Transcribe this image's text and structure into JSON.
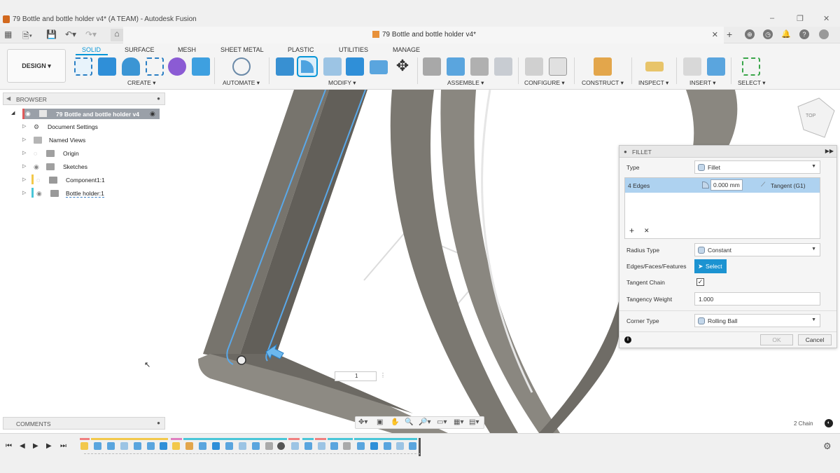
{
  "window": {
    "title": "79 Bottle and bottle holder v4* (A TEAM) - Autodesk Fusion",
    "minimize": "–",
    "restore": "❐",
    "close": "✕"
  },
  "doc_tab": {
    "label": "79 Bottle and bottle holder v4*",
    "close": "✕"
  },
  "ribbon": {
    "workspace": "DESIGN ▾",
    "tabs": [
      "SOLID",
      "SURFACE",
      "MESH",
      "SHEET METAL",
      "PLASTIC",
      "UTILITIES",
      "MANAGE"
    ],
    "groups": [
      "CREATE ▾",
      "AUTOMATE ▾",
      "MODIFY ▾",
      "ASSEMBLE ▾",
      "CONFIGURE ▾",
      "CONSTRUCT ▾",
      "INSPECT ▾",
      "INSERT ▾",
      "SELECT ▾"
    ]
  },
  "browser": {
    "header": "BROWSER",
    "root": "79 Bottle and bottle holder v4",
    "items": [
      "Document Settings",
      "Named Views",
      "Origin",
      "Sketches",
      "Component1:1",
      "Bottle holder:1"
    ]
  },
  "comments": {
    "header": "COMMENTS"
  },
  "fillet": {
    "title": "FILLET",
    "type_label": "Type",
    "type_value": "Fillet",
    "edges_count": "4 Edges",
    "edges_value": "0.000 mm",
    "edges_continuity": "Tangent (G1)",
    "add": "+",
    "remove": "✕",
    "radius_type_label": "Radius Type",
    "radius_type_value": "Constant",
    "efl_label": "Edges/Faces/Features",
    "select_btn": "Select",
    "tangent_chain_label": "Tangent Chain",
    "tangent_chain_checked": "✓",
    "tangency_weight_label": "Tangency Weight",
    "tangency_weight_value": "1.000",
    "corner_type_label": "Corner Type",
    "corner_type_value": "Rolling Ball",
    "ok": "OK",
    "cancel": "Cancel",
    "info": "i"
  },
  "viewport": {
    "value_input": "1",
    "chain_status": "2 Chain",
    "viewcube_label": "TOP"
  },
  "colors": {
    "accent": "#0696d7",
    "selected_row": "#aed2f0",
    "select_button": "#1c93d1",
    "model": "#807d76"
  }
}
